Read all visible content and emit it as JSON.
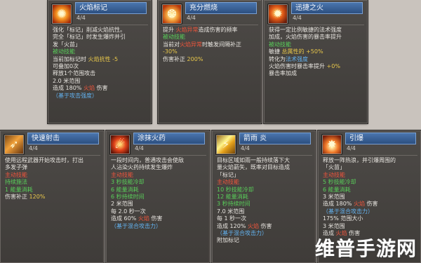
{
  "cards": [
    {
      "title": "火焰标记",
      "level": "4/4",
      "icon": "fire-mark-icon",
      "lines": [
        [
          {
            "t": "强化「标记」削减火焰抗性。",
            "c": "w"
          }
        ],
        [
          {
            "t": "完全「标记」时发生爆炸并引",
            "c": "w"
          }
        ],
        [
          {
            "t": "发「火苗」",
            "c": "w"
          }
        ],
        [
          {
            "t": "被动技能",
            "c": "g"
          }
        ],
        [
          {
            "t": "当前加标记时 ",
            "c": "w"
          },
          {
            "t": "火焰抗性 -5",
            "c": "y"
          }
        ],
        [
          {
            "t": "可叠加0次",
            "c": "w"
          }
        ],
        [
          {
            "t": "释放1个范围攻击",
            "c": "w"
          }
        ],
        [
          {
            "t": "2.0 米范围",
            "c": "w"
          }
        ],
        [
          {
            "t": "造成 180% ",
            "c": "w"
          },
          {
            "t": "火焰",
            "c": "r"
          },
          {
            "t": " 伤害",
            "c": "w"
          }
        ],
        [
          {
            "t": "（基于攻击强度）",
            "c": "b"
          }
        ]
      ]
    },
    {
      "title": "充分燃烧",
      "level": "4/4",
      "icon": "full-burn-icon",
      "lines": [
        [
          {
            "t": "提升 ",
            "c": "w"
          },
          {
            "t": "火焰异常",
            "c": "r"
          },
          {
            "t": "造成伤害的频率",
            "c": "w"
          }
        ],
        [
          {
            "t": "被动技能",
            "c": "g"
          }
        ],
        [
          {
            "t": "当前对",
            "c": "w"
          },
          {
            "t": "火焰异常",
            "c": "r"
          },
          {
            "t": "时触发间隔补正",
            "c": "w"
          }
        ],
        [
          {
            "t": "-30%",
            "c": "y"
          }
        ],
        [
          {
            "t": "伤害补正 ",
            "c": "w"
          },
          {
            "t": "200%",
            "c": "y"
          }
        ]
      ]
    },
    {
      "title": "迅捷之火",
      "level": "4/4",
      "icon": "swift-fire-icon",
      "lines": [
        [
          {
            "t": "获得一定比例敏捷的法术强度",
            "c": "w"
          }
        ],
        [
          {
            "t": "加成，火焰伤害的暴击率提升",
            "c": "w"
          }
        ],
        [
          {
            "t": "被动技能",
            "c": "g"
          }
        ],
        [
          {
            "t": "敏捷 ",
            "c": "w"
          },
          {
            "t": "总属性的 +50%",
            "c": "y"
          }
        ],
        [
          {
            "t": "转化为",
            "c": "w"
          },
          {
            "t": "法术强度",
            "c": "b"
          }
        ],
        [
          {
            "t": "火焰伤害时暴击率提升 ",
            "c": "w"
          },
          {
            "t": "+0%",
            "c": "y"
          }
        ],
        [
          {
            "t": "暴击率加成",
            "c": "w"
          }
        ]
      ]
    },
    {
      "title": "快速射击",
      "level": "4/4",
      "icon": "rapid-shot-icon",
      "lines": [
        [
          {
            "t": "使用远程武器开始攻击时，打出",
            "c": "w"
          }
        ],
        [
          {
            "t": "多发子弹",
            "c": "w"
          }
        ],
        [
          {
            "t": "主动技能",
            "c": "r"
          }
        ],
        [
          {
            "t": "持续施法",
            "c": "g"
          }
        ],
        [
          {
            "t": "1 能量消耗",
            "c": "g"
          }
        ],
        [
          {
            "t": "伤害补正 ",
            "c": "w"
          },
          {
            "t": "120%",
            "c": "y"
          }
        ]
      ]
    },
    {
      "title": "涂抹火药",
      "level": "4/4",
      "icon": "gunpowder-icon",
      "lines": [
        [
          {
            "t": "一段时间内，普通攻击会使敌",
            "c": "w"
          }
        ],
        [
          {
            "t": "人沾染火药持续发生爆炸",
            "c": "w"
          }
        ],
        [
          {
            "t": "主动技能",
            "c": "r"
          }
        ],
        [
          {
            "t": "3 秒技能冷却",
            "c": "g"
          }
        ],
        [
          {
            "t": "6 能量消耗",
            "c": "g"
          }
        ],
        [
          {
            "t": "6 秒持续时间",
            "c": "g"
          }
        ],
        [
          {
            "t": "2 米范围",
            "c": "w"
          }
        ],
        [
          {
            "t": "每 2.0 秒一次",
            "c": "w"
          }
        ],
        [
          {
            "t": "造成 60% ",
            "c": "w"
          },
          {
            "t": "火焰",
            "c": "r"
          },
          {
            "t": " 伤害",
            "c": "w"
          }
        ],
        [
          {
            "t": "（基于混合攻击力）",
            "c": "b"
          }
        ]
      ]
    },
    {
      "title": "箭雨 炎",
      "level": "4/4",
      "icon": "arrow-rain-icon",
      "lines": [
        [
          {
            "t": "目标区域如雨一般持续落下大",
            "c": "w"
          }
        ],
        [
          {
            "t": "量火焰箭矢，既率对目标造成",
            "c": "w"
          }
        ],
        [
          {
            "t": "「标记」",
            "c": "w"
          }
        ],
        [
          {
            "t": "主动技能",
            "c": "r"
          }
        ],
        [
          {
            "t": "10 秒技能冷却",
            "c": "g"
          }
        ],
        [
          {
            "t": "12 能量消耗",
            "c": "g"
          }
        ],
        [
          {
            "t": "3 秒持续时间",
            "c": "g"
          }
        ],
        [
          {
            "t": "7.0 米范围",
            "c": "w"
          }
        ],
        [
          {
            "t": "每 1 秒一次",
            "c": "w"
          }
        ],
        [
          {
            "t": "造成 120% ",
            "c": "w"
          },
          {
            "t": "火焰",
            "c": "r"
          },
          {
            "t": " 伤害",
            "c": "w"
          }
        ],
        [
          {
            "t": "（基于混合攻击力）",
            "c": "b"
          }
        ],
        [
          {
            "t": "附加标记",
            "c": "w"
          }
        ]
      ]
    },
    {
      "title": "引爆",
      "level": "4/4",
      "icon": "detonate-icon",
      "lines": [
        [
          {
            "t": "释放一阵热浪，并引爆周围的",
            "c": "w"
          }
        ],
        [
          {
            "t": "「火苗」",
            "c": "w"
          }
        ],
        [
          {
            "t": "主动技能",
            "c": "r"
          }
        ],
        [
          {
            "t": "5 秒技能冷却",
            "c": "g"
          }
        ],
        [
          {
            "t": "6 能量消耗",
            "c": "g"
          }
        ],
        [
          {
            "t": "3 米范围",
            "c": "w"
          }
        ],
        [
          {
            "t": "造成 180% ",
            "c": "w"
          },
          {
            "t": "火焰",
            "c": "r"
          },
          {
            "t": " 伤害",
            "c": "w"
          }
        ],
        [
          {
            "t": "（基于混合攻击力）",
            "c": "b"
          }
        ],
        [
          {
            "t": "175% 范围大小",
            "c": "w"
          }
        ],
        [
          {
            "t": "3 米范围",
            "c": "w"
          }
        ],
        [
          {
            "t": "造成 ",
            "c": "w"
          },
          {
            "t": "火焰",
            "c": "r"
          },
          {
            "t": " 伤害",
            "c": "w"
          }
        ]
      ]
    }
  ],
  "watermark": "维普手游网",
  "colors": {
    "title_bg": "#3d6498",
    "passive": "#59d05a",
    "active": "#f0553c",
    "number": "#e9c84a",
    "scaling": "#63b3f1"
  }
}
